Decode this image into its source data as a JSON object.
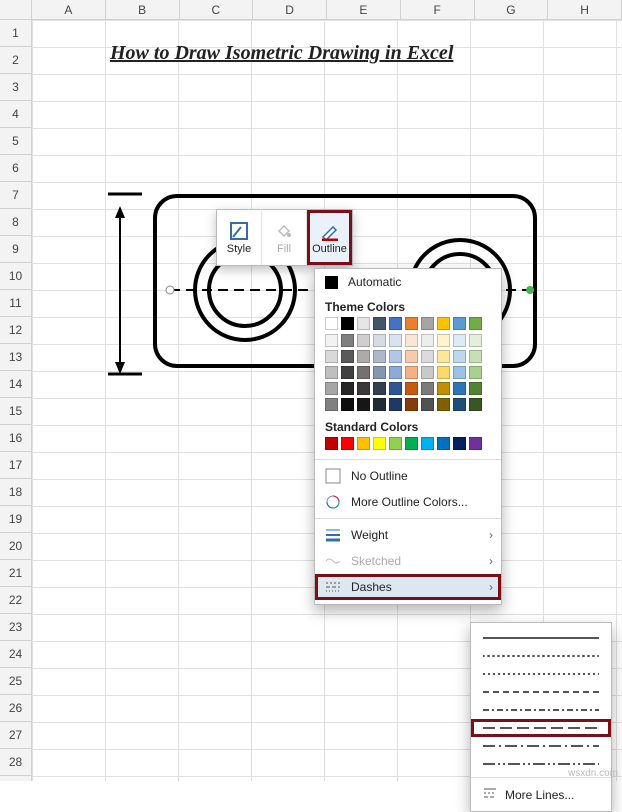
{
  "columns": [
    "A",
    "B",
    "C",
    "D",
    "E",
    "F",
    "G",
    "H"
  ],
  "rows": [
    "1",
    "2",
    "3",
    "4",
    "5",
    "6",
    "7",
    "8",
    "9",
    "10",
    "11",
    "12",
    "13",
    "14",
    "15",
    "16",
    "17",
    "18",
    "19",
    "20",
    "21",
    "22",
    "23",
    "24",
    "25",
    "26",
    "27",
    "28"
  ],
  "title": "How to Draw Isometric Drawing in Excel",
  "toolbar": {
    "style": "Style",
    "fill": "Fill",
    "outline": "Outline"
  },
  "dropdown": {
    "automatic": "Automatic",
    "theme_heading": "Theme Colors",
    "theme_colors_row1": [
      "#ffffff",
      "#000000",
      "#e7e6e6",
      "#44546a",
      "#4472c4",
      "#ed7d31",
      "#a5a5a5",
      "#ffc000",
      "#5b9bd5",
      "#70ad47"
    ],
    "theme_tint_columns": [
      [
        "#f2f2f2",
        "#d9d9d9",
        "#bfbfbf",
        "#a6a6a6",
        "#808080"
      ],
      [
        "#7f7f7f",
        "#595959",
        "#404040",
        "#262626",
        "#0d0d0d"
      ],
      [
        "#d0cece",
        "#aeaaaa",
        "#757171",
        "#3a3838",
        "#161616"
      ],
      [
        "#d6dce5",
        "#adb9ca",
        "#8497b0",
        "#333f50",
        "#222a35"
      ],
      [
        "#d9e1f2",
        "#b4c6e7",
        "#8ea9db",
        "#2f5597",
        "#203864"
      ],
      [
        "#fbe5d6",
        "#f7caac",
        "#f4b183",
        "#c55a11",
        "#833c0c"
      ],
      [
        "#ededed",
        "#dbdbdb",
        "#c9c9c9",
        "#7b7b7b",
        "#525252"
      ],
      [
        "#fff2cc",
        "#ffe699",
        "#ffd966",
        "#bf8f00",
        "#806000"
      ],
      [
        "#deebf7",
        "#bdd7ee",
        "#9cc3e6",
        "#2e75b6",
        "#1f4e79"
      ],
      [
        "#e2f0d9",
        "#c5e0b4",
        "#a9d18e",
        "#548235",
        "#385723"
      ]
    ],
    "standard_heading": "Standard Colors",
    "standard_colors": [
      "#c00000",
      "#ff0000",
      "#ffc000",
      "#ffff00",
      "#92d050",
      "#00b050",
      "#00b0f0",
      "#0070c0",
      "#002060",
      "#7030a0"
    ],
    "no_outline": "No Outline",
    "more_colors": "More Outline Colors...",
    "weight": "Weight",
    "sketched": "Sketched",
    "dashes": "Dashes"
  },
  "flyout": {
    "more_lines": "More Lines..."
  },
  "watermark": "wsxdn.com"
}
